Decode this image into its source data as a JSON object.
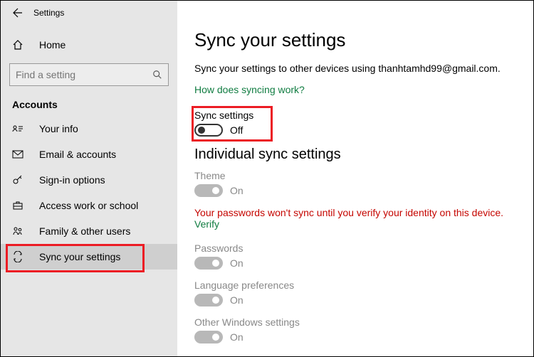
{
  "window": {
    "title": "Settings"
  },
  "sidebar": {
    "home": "Home",
    "search_placeholder": "Find a setting",
    "section": "Accounts",
    "items": [
      {
        "label": "Your info"
      },
      {
        "label": "Email & accounts"
      },
      {
        "label": "Sign-in options"
      },
      {
        "label": "Access work or school"
      },
      {
        "label": "Family & other users"
      },
      {
        "label": "Sync your settings"
      }
    ]
  },
  "main": {
    "heading": "Sync your settings",
    "description": "Sync your settings to other devices using thanhtamhd99@gmail.com.",
    "how_link": "How does syncing work?",
    "sync_label": "Sync settings",
    "sync_state": "Off",
    "sub_heading": "Individual sync settings",
    "theme_label": "Theme",
    "theme_state": "On",
    "password_warning": "Your passwords won't sync until you verify your identity on this device.",
    "verify": "Verify",
    "passwords_label": "Passwords",
    "passwords_state": "On",
    "lang_label": "Language preferences",
    "lang_state": "On",
    "other_label": "Other Windows settings",
    "other_state": "On"
  }
}
